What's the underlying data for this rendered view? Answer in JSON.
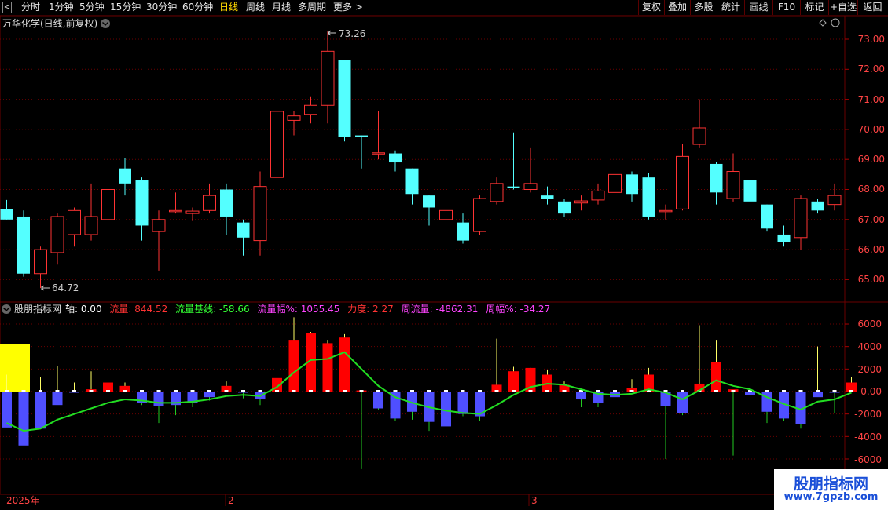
{
  "toolbar": {
    "back_arrow": "<",
    "periods": [
      "分时",
      "1分钟",
      "5分钟",
      "15分钟",
      "30分钟",
      "60分钟",
      "日线",
      "周线",
      "月线",
      "多周期",
      "更多 >"
    ],
    "active_period": "日线",
    "right_buttons": [
      "复权",
      "叠加",
      "多股",
      "统计",
      "画线",
      "F10",
      "标记",
      "+自选",
      "返回"
    ]
  },
  "main_panel": {
    "title": "万华化学(日线,前复权)",
    "max_label": "73.26",
    "min_label": "64.72",
    "y_ticks": [
      "73.00",
      "72.00",
      "71.00",
      "70.00",
      "69.00",
      "68.00",
      "67.00",
      "66.00",
      "65.00"
    ]
  },
  "indicator_panel": {
    "name": "股朋指标网",
    "legend": [
      {
        "label": "轴: 0.00",
        "color": "#ffffff"
      },
      {
        "label": "流量: 844.52",
        "color": "#ff3333"
      },
      {
        "label": "流量基线: -58.66",
        "color": "#33ff33"
      },
      {
        "label": "流量幅%: 1055.45",
        "color": "#ff44ff"
      },
      {
        "label": "力度: 2.27",
        "color": "#ff3333"
      },
      {
        "label": "周流量: -4862.31",
        "color": "#ff44ff"
      },
      {
        "label": "周幅%: -34.27",
        "color": "#ff44ff"
      }
    ],
    "y_ticks": [
      "6000",
      "4000",
      "2000",
      "0.00",
      "-2000",
      "-4000",
      "-6000"
    ]
  },
  "date_axis": {
    "labels": [
      "2025年",
      "2",
      "3"
    ]
  },
  "watermark": {
    "line1": "股朋指标网",
    "line2": "www.7gpzb.com"
  },
  "colors": {
    "up": "#ff3333",
    "down": "#54ffff",
    "bar_up": "#ff0000",
    "bar_down": "#4f4fff",
    "baseline": "#22dd22",
    "highlight": "#ffff00",
    "grid": "#6a0000"
  },
  "chart_data": {
    "type": "candlestick",
    "candles": [
      {
        "o": 67.35,
        "h": 67.65,
        "l": 67.0,
        "c": 67.0
      },
      {
        "o": 67.1,
        "h": 67.3,
        "l": 65.1,
        "c": 65.2
      },
      {
        "o": 65.2,
        "h": 66.1,
        "l": 64.72,
        "c": 66.0
      },
      {
        "o": 65.9,
        "h": 67.2,
        "l": 65.5,
        "c": 67.1
      },
      {
        "o": 66.5,
        "h": 67.4,
        "l": 66.1,
        "c": 67.3
      },
      {
        "o": 66.5,
        "h": 68.2,
        "l": 66.3,
        "c": 67.1
      },
      {
        "o": 67.0,
        "h": 68.5,
        "l": 66.6,
        "c": 68.0
      },
      {
        "o": 68.7,
        "h": 69.05,
        "l": 67.8,
        "c": 68.2
      },
      {
        "o": 68.3,
        "h": 68.4,
        "l": 66.3,
        "c": 66.8
      },
      {
        "o": 66.6,
        "h": 67.3,
        "l": 65.3,
        "c": 67.0
      },
      {
        "o": 67.3,
        "h": 67.9,
        "l": 67.2,
        "c": 67.3
      },
      {
        "o": 67.2,
        "h": 67.4,
        "l": 66.95,
        "c": 67.28
      },
      {
        "o": 67.3,
        "h": 68.2,
        "l": 67.2,
        "c": 67.8
      },
      {
        "o": 68.0,
        "h": 68.2,
        "l": 66.5,
        "c": 67.1
      },
      {
        "o": 66.9,
        "h": 67.0,
        "l": 65.8,
        "c": 66.4
      },
      {
        "o": 66.3,
        "h": 68.6,
        "l": 65.8,
        "c": 68.1
      },
      {
        "o": 68.4,
        "h": 70.9,
        "l": 68.3,
        "c": 70.6
      },
      {
        "o": 70.3,
        "h": 70.6,
        "l": 69.8,
        "c": 70.45
      },
      {
        "o": 70.5,
        "h": 71.1,
        "l": 70.2,
        "c": 70.8
      },
      {
        "o": 70.8,
        "h": 73.26,
        "l": 70.2,
        "c": 72.6
      },
      {
        "o": 72.3,
        "h": 72.3,
        "l": 69.6,
        "c": 69.75
      },
      {
        "o": 69.8,
        "h": 69.8,
        "l": 68.7,
        "c": 69.75
      },
      {
        "o": 69.2,
        "h": 70.6,
        "l": 69.0,
        "c": 69.22
      },
      {
        "o": 69.2,
        "h": 69.3,
        "l": 68.6,
        "c": 68.9
      },
      {
        "o": 68.7,
        "h": 68.7,
        "l": 67.5,
        "c": 67.85
      },
      {
        "o": 67.8,
        "h": 67.8,
        "l": 66.8,
        "c": 67.4
      },
      {
        "o": 67.0,
        "h": 67.8,
        "l": 66.9,
        "c": 67.3
      },
      {
        "o": 66.9,
        "h": 67.2,
        "l": 66.2,
        "c": 66.3
      },
      {
        "o": 66.6,
        "h": 67.8,
        "l": 66.5,
        "c": 67.7
      },
      {
        "o": 67.6,
        "h": 68.4,
        "l": 67.5,
        "c": 68.2
      },
      {
        "o": 68.1,
        "h": 69.9,
        "l": 68.0,
        "c": 68.05
      },
      {
        "o": 68.0,
        "h": 69.4,
        "l": 67.9,
        "c": 68.2
      },
      {
        "o": 67.8,
        "h": 68.1,
        "l": 67.5,
        "c": 67.7
      },
      {
        "o": 67.6,
        "h": 67.7,
        "l": 67.1,
        "c": 67.2
      },
      {
        "o": 67.55,
        "h": 67.8,
        "l": 67.3,
        "c": 67.62
      },
      {
        "o": 67.65,
        "h": 68.2,
        "l": 67.5,
        "c": 67.95
      },
      {
        "o": 67.9,
        "h": 68.9,
        "l": 67.5,
        "c": 68.5
      },
      {
        "o": 68.5,
        "h": 68.6,
        "l": 67.6,
        "c": 67.85
      },
      {
        "o": 68.4,
        "h": 68.55,
        "l": 67.0,
        "c": 67.1
      },
      {
        "o": 67.3,
        "h": 67.5,
        "l": 67.0,
        "c": 67.3
      },
      {
        "o": 67.35,
        "h": 69.5,
        "l": 67.3,
        "c": 69.1
      },
      {
        "o": 69.5,
        "h": 71.0,
        "l": 69.4,
        "c": 70.05
      },
      {
        "o": 68.85,
        "h": 68.9,
        "l": 67.5,
        "c": 67.9
      },
      {
        "o": 67.7,
        "h": 69.2,
        "l": 67.6,
        "c": 68.6
      },
      {
        "o": 68.3,
        "h": 68.3,
        "l": 67.5,
        "c": 67.6
      },
      {
        "o": 67.5,
        "h": 67.5,
        "l": 66.6,
        "c": 66.7
      },
      {
        "o": 66.5,
        "h": 66.8,
        "l": 66.1,
        "c": 66.25
      },
      {
        "o": 66.4,
        "h": 67.8,
        "l": 65.98,
        "c": 67.7
      },
      {
        "o": 67.6,
        "h": 67.7,
        "l": 67.2,
        "c": 67.3
      },
      {
        "o": 67.5,
        "h": 68.2,
        "l": 67.3,
        "c": 67.8
      }
    ],
    "flow": [
      -3200,
      -4800,
      -3300,
      -1200,
      -100,
      200,
      800,
      500,
      -1000,
      -1300,
      -1200,
      -1000,
      -500,
      500,
      -100,
      -700,
      1200,
      4600,
      5200,
      4300,
      4800,
      100,
      -1500,
      -2400,
      -1800,
      -2700,
      -3100,
      -2000,
      -2200,
      600,
      1800,
      2100,
      1500,
      600,
      -700,
      -1000,
      -500,
      300,
      1500,
      -1300,
      -1900,
      700,
      2600,
      200,
      -300,
      -1800,
      -2400,
      -2900,
      -500,
      -100,
      800
    ],
    "flow_wick": [
      1500,
      0,
      1300,
      2300,
      800,
      1800,
      1200,
      800,
      -1200,
      -2800,
      -2100,
      -1400,
      -800,
      900,
      -600,
      -1200,
      5100,
      6600,
      5300,
      4600,
      5100,
      -6900,
      -1600,
      -2600,
      -2500,
      -3500,
      -3200,
      -2200,
      -2600,
      4700,
      2200,
      2100,
      1900,
      900,
      -1400,
      -1400,
      -1000,
      1100,
      2100,
      -6000,
      -2100,
      5900,
      4600,
      -5700,
      -1200,
      -2800,
      -2600,
      -3300,
      4000,
      -1900,
      1300
    ],
    "baseline_values": [
      -2800,
      -3500,
      -3300,
      -2500,
      -2000,
      -1500,
      -1000,
      -700,
      -800,
      -1000,
      -1000,
      -900,
      -700,
      -400,
      -300,
      -400,
      400,
      1700,
      2800,
      2900,
      3500,
      2000,
      500,
      -500,
      -1000,
      -1400,
      -1700,
      -1900,
      -2000,
      -1200,
      -300,
      400,
      700,
      600,
      200,
      -200,
      -300,
      -200,
      200,
      -100,
      -700,
      100,
      1000,
      500,
      200,
      -500,
      -1100,
      -1600,
      -900,
      -700,
      -100
    ],
    "highlight_block": {
      "index": 1,
      "value": 4200
    }
  }
}
